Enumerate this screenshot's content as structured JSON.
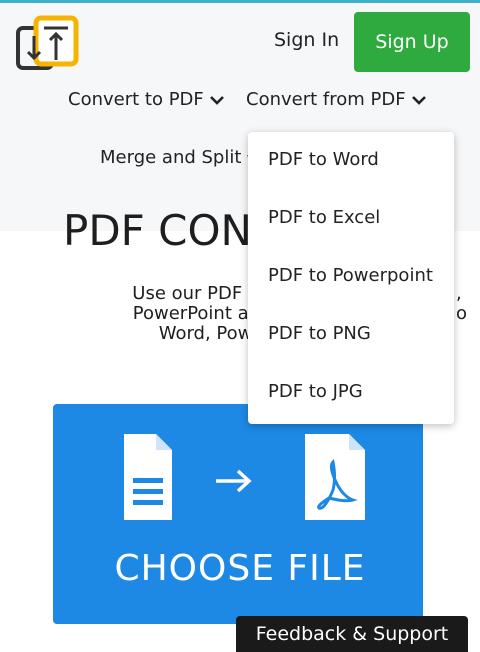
{
  "header": {
    "sign_in": "Sign In",
    "sign_up": "Sign Up",
    "nav": {
      "convert_to_pdf": "Convert to PDF",
      "convert_from_pdf": "Convert from PDF",
      "merge_split": "Merge and Split"
    }
  },
  "main": {
    "title": "PDF CON",
    "subtitle": [
      "Use our PDF converter t",
      "PowerPoint and other fil",
      "Word, PowerPoint,"
    ],
    "subtitle_right": [
      ",",
      "o"
    ],
    "choose_file": "CHOOSE FILE"
  },
  "dropdown": {
    "items": [
      "PDF to Word",
      "PDF to Excel",
      "PDF to Powerpoint",
      "PDF to PNG",
      "PDF to JPG"
    ]
  },
  "feedback": "Feedback & Support",
  "colors": {
    "brand_green": "#2eaa3f",
    "dropzone_blue": "#1e88e5",
    "logo_yellow": "#f5b400"
  },
  "icons": [
    "logo-icon",
    "chevron-down-icon",
    "document-icon",
    "arrow-right-icon",
    "pdf-file-icon"
  ]
}
